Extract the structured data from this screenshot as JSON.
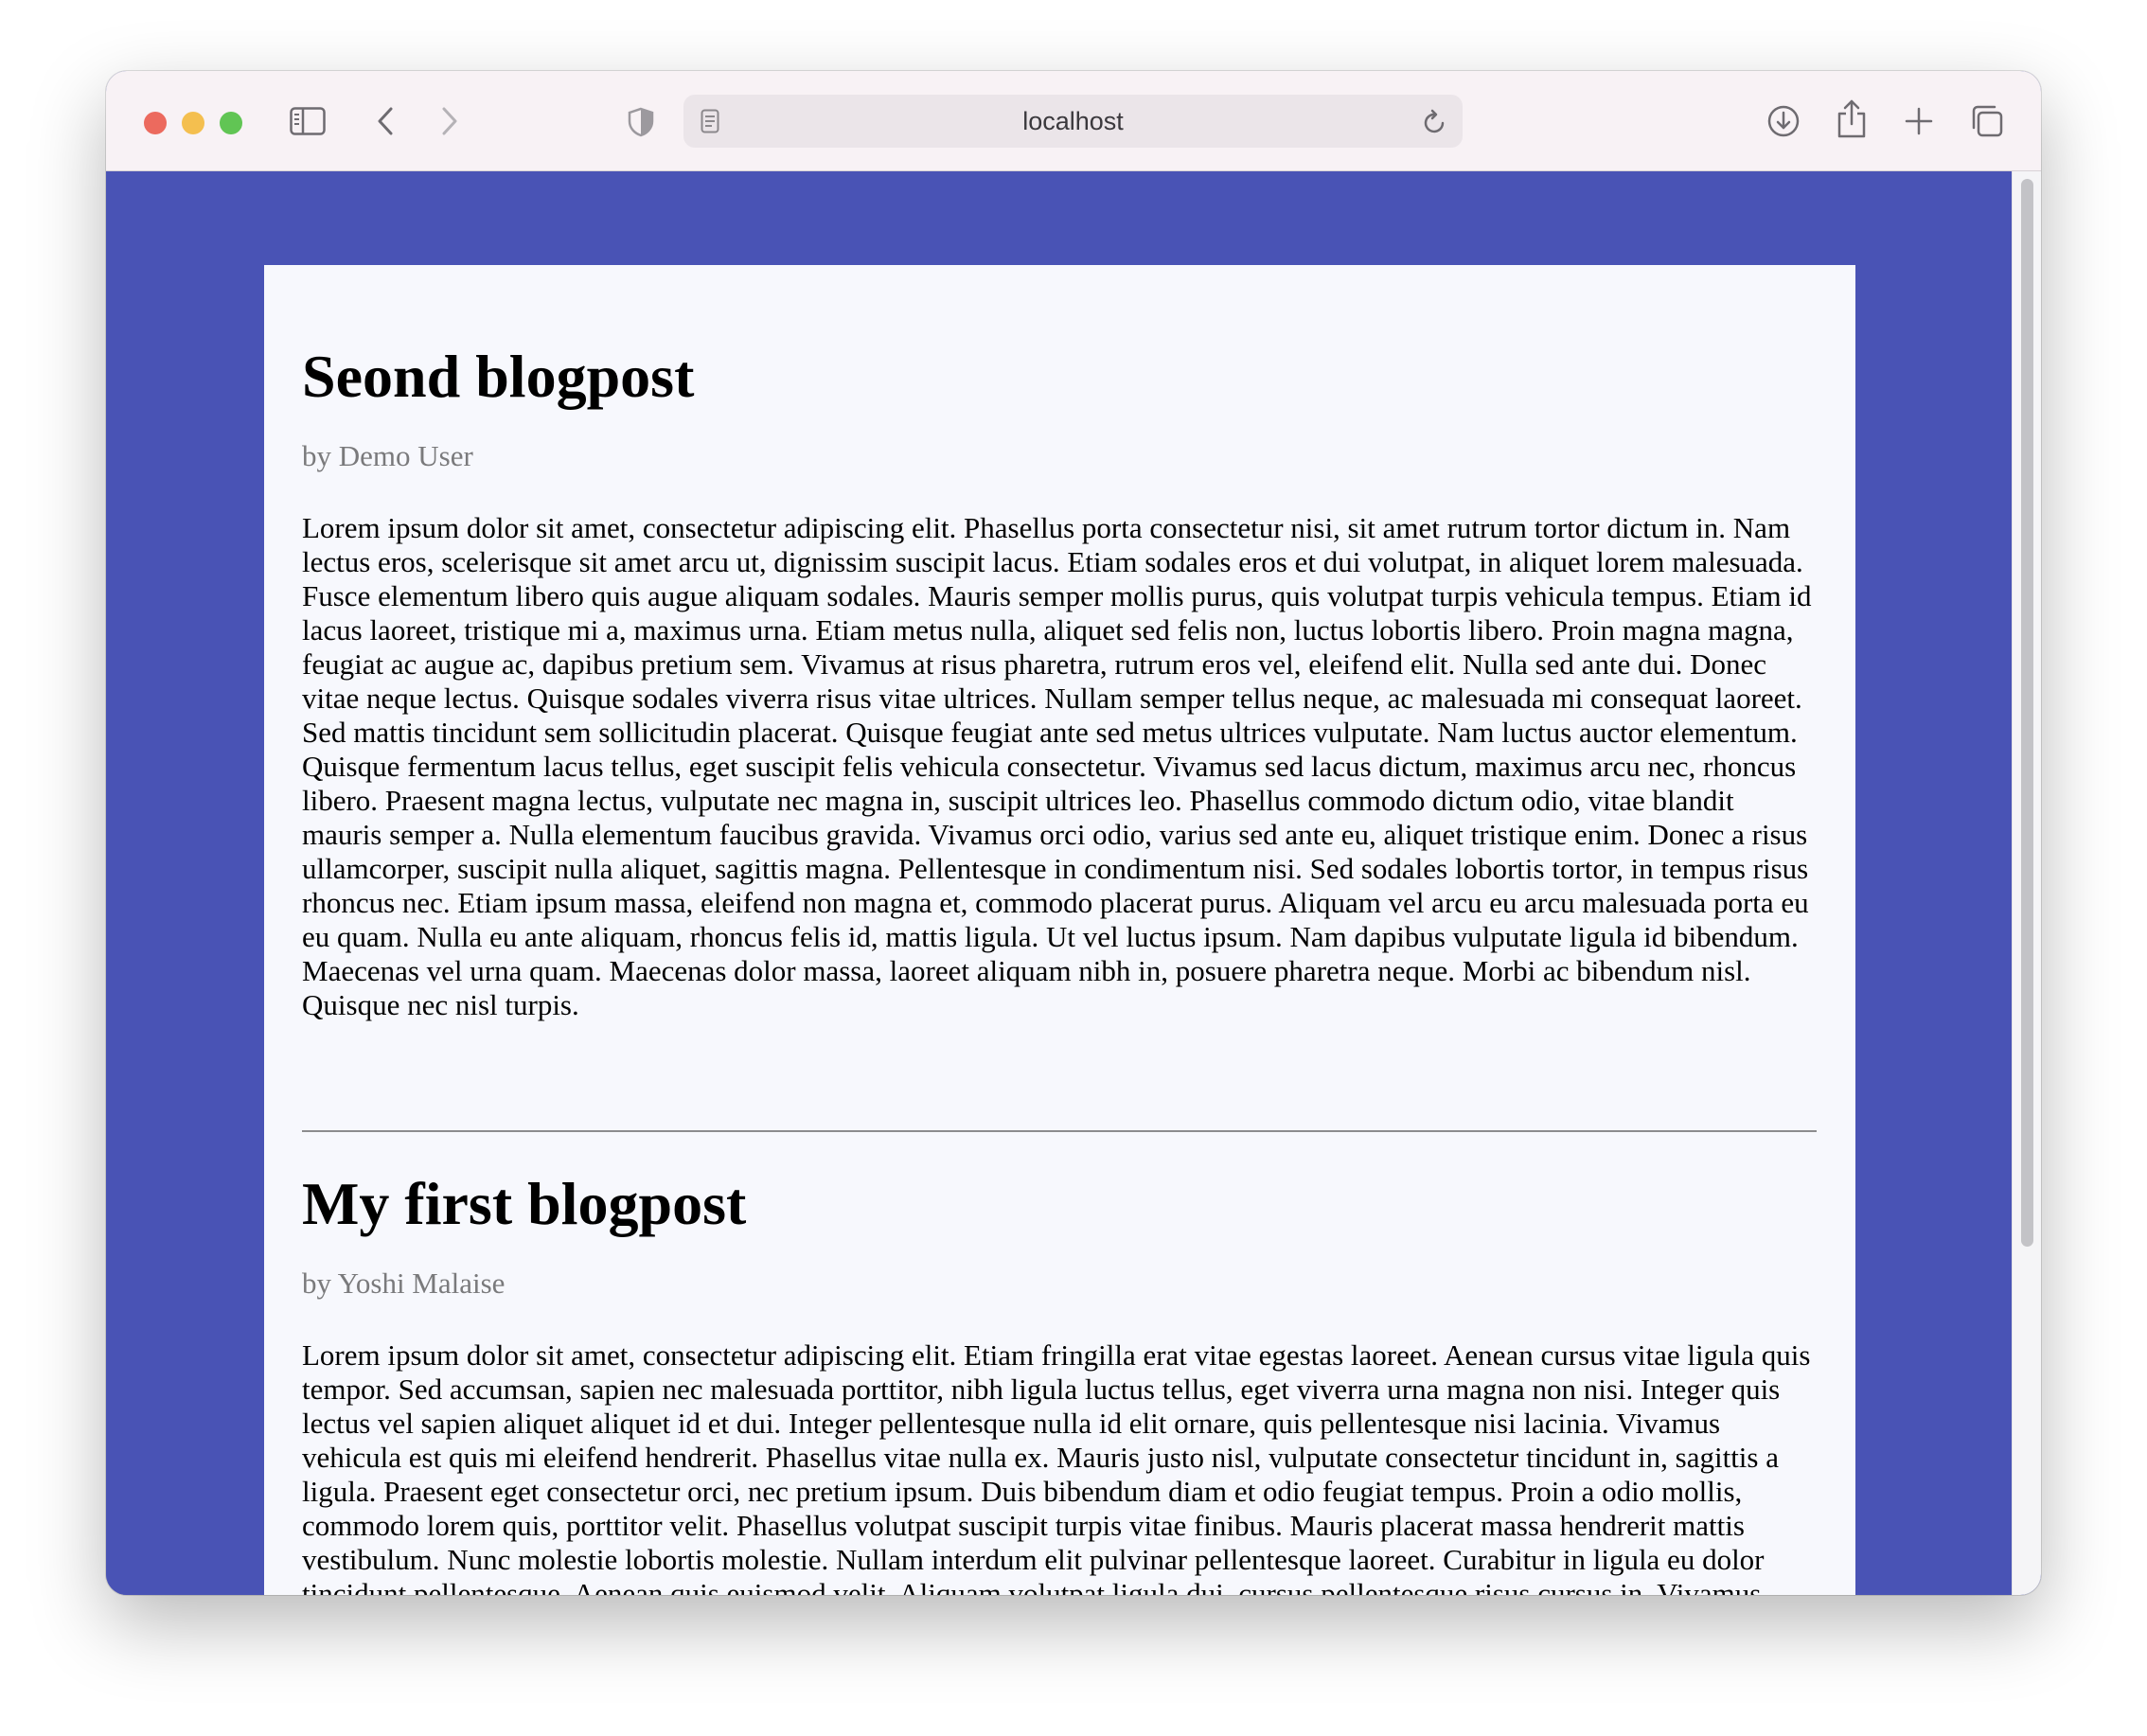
{
  "browser": {
    "url": "localhost",
    "colors": {
      "close": "#ec6a5e",
      "minimize": "#f4bf4f",
      "zoom": "#61c554",
      "page_background": "#4953b5",
      "card_background": "#f7f8fd"
    },
    "icons": {
      "sidebar": "sidebar-icon",
      "back": "chevron-left-icon",
      "forward": "chevron-right-icon",
      "privacy": "shield-icon",
      "page": "page-icon",
      "reload": "reload-icon",
      "download": "download-icon",
      "share": "share-icon",
      "new_tab": "plus-icon",
      "tabs": "tab-overview-icon"
    }
  },
  "posts": [
    {
      "title": "Seond blogpost",
      "author": "by Demo User",
      "body": "Lorem ipsum dolor sit amet, consectetur adipiscing elit. Phasellus porta consectetur nisi, sit amet rutrum tortor dictum in. Nam lectus eros, scelerisque sit amet arcu ut, dignissim suscipit lacus. Etiam sodales eros et dui volutpat, in aliquet lorem malesuada. Fusce elementum libero quis augue aliquam sodales. Mauris semper mollis purus, quis volutpat turpis vehicula tempus. Etiam id lacus laoreet, tristique mi a, maximus urna. Etiam metus nulla, aliquet sed felis non, luctus lobortis libero. Proin magna magna, feugiat ac augue ac, dapibus pretium sem. Vivamus at risus pharetra, rutrum eros vel, eleifend elit. Nulla sed ante dui. Donec vitae neque lectus. Quisque sodales viverra risus vitae ultrices. Nullam semper tellus neque, ac malesuada mi consequat laoreet. Sed mattis tincidunt sem sollicitudin placerat. Quisque feugiat ante sed metus ultrices vulputate. Nam luctus auctor elementum. Quisque fermentum lacus tellus, eget suscipit felis vehicula consectetur. Vivamus sed lacus dictum, maximus arcu nec, rhoncus libero. Praesent magna lectus, vulputate nec magna in, suscipit ultrices leo. Phasellus commodo dictum odio, vitae blandit mauris semper a. Nulla elementum faucibus gravida. Vivamus orci odio, varius sed ante eu, aliquet tristique enim. Donec a risus ullamcorper, suscipit nulla aliquet, sagittis magna. Pellentesque in condimentum nisi. Sed sodales lobortis tortor, in tempus risus rhoncus nec. Etiam ipsum massa, eleifend non magna et, commodo placerat purus. Aliquam vel arcu eu arcu malesuada porta eu eu quam. Nulla eu ante aliquam, rhoncus felis id, mattis ligula. Ut vel luctus ipsum. Nam dapibus vulputate ligula id bibendum. Maecenas vel urna quam. Maecenas dolor massa, laoreet aliquam nibh in, posuere pharetra neque. Morbi ac bibendum nisl. Quisque nec nisl turpis."
    },
    {
      "title": "My first blogpost",
      "author": "by Yoshi Malaise",
      "body": "Lorem ipsum dolor sit amet, consectetur adipiscing elit. Etiam fringilla erat vitae egestas laoreet. Aenean cursus vitae ligula quis tempor. Sed accumsan, sapien nec malesuada porttitor, nibh ligula luctus tellus, eget viverra urna magna non nisi. Integer quis lectus vel sapien aliquet aliquet id et dui. Integer pellentesque nulla id elit ornare, quis pellentesque nisi lacinia. Vivamus vehicula est quis mi eleifend hendrerit. Phasellus vitae nulla ex. Mauris justo nisl, vulputate consectetur tincidunt in, sagittis a ligula. Praesent eget consectetur orci, nec pretium ipsum. Duis bibendum diam et odio feugiat tempus. Proin a odio mollis, commodo lorem quis, porttitor velit. Phasellus volutpat suscipit turpis vitae finibus. Mauris placerat massa hendrerit mattis vestibulum. Nunc molestie lobortis molestie. Nullam interdum elit pulvinar pellentesque laoreet. Curabitur in ligula eu dolor tincidunt pellentesque. Aenean quis euismod velit. Aliquam volutpat ligula dui, cursus pellentesque risus cursus in. Vivamus condimentum convallis lobortis. Integer rhoncus commodo enim eu elementum. Morbi vel massa"
    }
  ]
}
